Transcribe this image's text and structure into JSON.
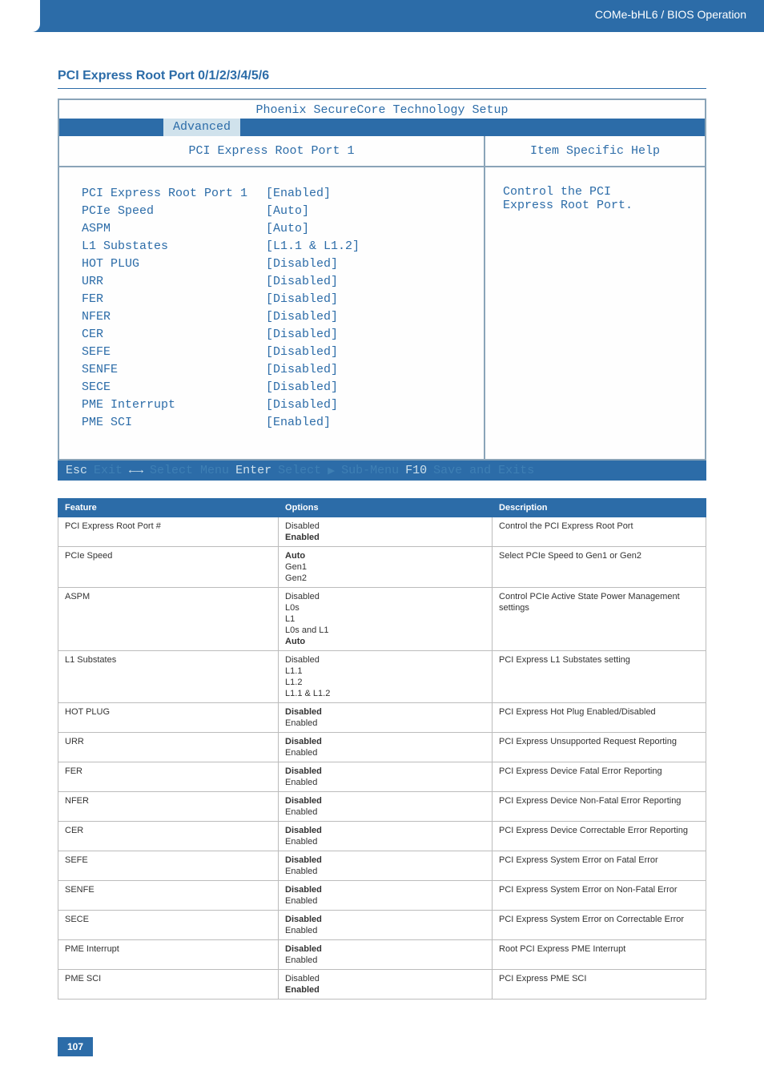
{
  "header": {
    "breadcrumb": "COMe-bHL6 / BIOS Operation"
  },
  "section_title": "PCI Express Root Port 0/1/2/3/4/5/6",
  "bios": {
    "title": "Phoenix SecureCore Technology Setup",
    "tab": "Advanced",
    "left_header": "PCI Express Root Port 1",
    "right_header": "Item Specific Help",
    "help_text_1": "Control the PCI",
    "help_text_2": "Express Root Port.",
    "rows": [
      {
        "label": "PCI Express Root Port 1",
        "value": "[Enabled]"
      },
      {
        "label": "PCIe Speed",
        "value": "[Auto]"
      },
      {
        "label": "ASPM",
        "value": "[Auto]"
      },
      {
        "label": "L1 Substates",
        "value": "[L1.1 & L1.2]"
      },
      {
        "label": "HOT PLUG",
        "value": "[Disabled]"
      },
      {
        "label": "URR",
        "value": "[Disabled]"
      },
      {
        "label": "FER",
        "value": "[Disabled]"
      },
      {
        "label": "NFER",
        "value": "[Disabled]"
      },
      {
        "label": "CER",
        "value": "[Disabled]"
      },
      {
        "label": "SEFE",
        "value": "[Disabled]"
      },
      {
        "label": "SENFE",
        "value": "[Disabled]"
      },
      {
        "label": "SECE",
        "value": "[Disabled]"
      },
      {
        "label": "PME Interrupt",
        "value": "[Disabled]"
      },
      {
        "label": "PME SCI",
        "value": "[Enabled]"
      }
    ],
    "footer": {
      "esc": "Esc",
      "exit": "Exit",
      "arrows": "←→",
      "select_menu": "Select Menu",
      "enter": "Enter",
      "select": "Select",
      "arr": "▶",
      "submenu": "Sub-Menu",
      "f10": "F10",
      "save": "Save and Exits"
    }
  },
  "table": {
    "headers": {
      "feature": "Feature",
      "options": "Options",
      "description": "Description"
    },
    "rows": [
      {
        "feature": "PCI Express Root Port #",
        "options": [
          {
            "t": "Disabled"
          },
          {
            "t": "Enabled",
            "b": true
          }
        ],
        "desc": "Control the PCI Express Root Port"
      },
      {
        "feature": "PCIe Speed",
        "options": [
          {
            "t": "Auto",
            "b": true
          },
          {
            "t": "Gen1"
          },
          {
            "t": "Gen2"
          }
        ],
        "desc": "Select PCIe Speed to Gen1 or Gen2"
      },
      {
        "feature": "ASPM",
        "options": [
          {
            "t": "Disabled"
          },
          {
            "t": "L0s"
          },
          {
            "t": "L1"
          },
          {
            "t": "L0s and L1"
          },
          {
            "t": "Auto",
            "b": true
          }
        ],
        "desc": "Control PCIe Active State Power Management settings"
      },
      {
        "feature": "L1 Substates",
        "options": [
          {
            "t": "Disabled"
          },
          {
            "t": "L1.1"
          },
          {
            "t": "L1.2"
          },
          {
            "t": "L1.1 & L1.2"
          }
        ],
        "desc": "PCI Express L1 Substates setting"
      },
      {
        "feature": "HOT PLUG",
        "options": [
          {
            "t": "Disabled",
            "b": true
          },
          {
            "t": "Enabled"
          }
        ],
        "desc": "PCI Express Hot Plug Enabled/Disabled"
      },
      {
        "feature": "URR",
        "options": [
          {
            "t": "Disabled",
            "b": true
          },
          {
            "t": "Enabled"
          }
        ],
        "desc": "PCI Express Unsupported Request Reporting"
      },
      {
        "feature": "FER",
        "options": [
          {
            "t": "Disabled",
            "b": true
          },
          {
            "t": "Enabled"
          }
        ],
        "desc": "PCI Express Device Fatal Error Reporting"
      },
      {
        "feature": "NFER",
        "options": [
          {
            "t": "Disabled",
            "b": true
          },
          {
            "t": "Enabled"
          }
        ],
        "desc": "PCI Express Device Non-Fatal Error Reporting"
      },
      {
        "feature": "CER",
        "options": [
          {
            "t": "Disabled",
            "b": true
          },
          {
            "t": "Enabled"
          }
        ],
        "desc": "PCI Express Device Correctable Error Reporting"
      },
      {
        "feature": "SEFE",
        "options": [
          {
            "t": "Disabled",
            "b": true
          },
          {
            "t": "Enabled"
          }
        ],
        "desc": "PCI Express System Error on Fatal Error"
      },
      {
        "feature": "SENFE",
        "options": [
          {
            "t": "Disabled",
            "b": true
          },
          {
            "t": "Enabled"
          }
        ],
        "desc": "PCI Express System Error on Non-Fatal Error"
      },
      {
        "feature": "SECE",
        "options": [
          {
            "t": "Disabled",
            "b": true
          },
          {
            "t": "Enabled"
          }
        ],
        "desc": "PCI Express System Error on Correctable Error"
      },
      {
        "feature": "PME Interrupt",
        "options": [
          {
            "t": "Disabled",
            "b": true
          },
          {
            "t": "Enabled"
          }
        ],
        "desc": "Root PCI Express PME Interrupt"
      },
      {
        "feature": "PME SCI",
        "options": [
          {
            "t": "Disabled"
          },
          {
            "t": "Enabled",
            "b": true
          }
        ],
        "desc": "PCI Express PME SCI"
      }
    ]
  },
  "page_number": "107"
}
